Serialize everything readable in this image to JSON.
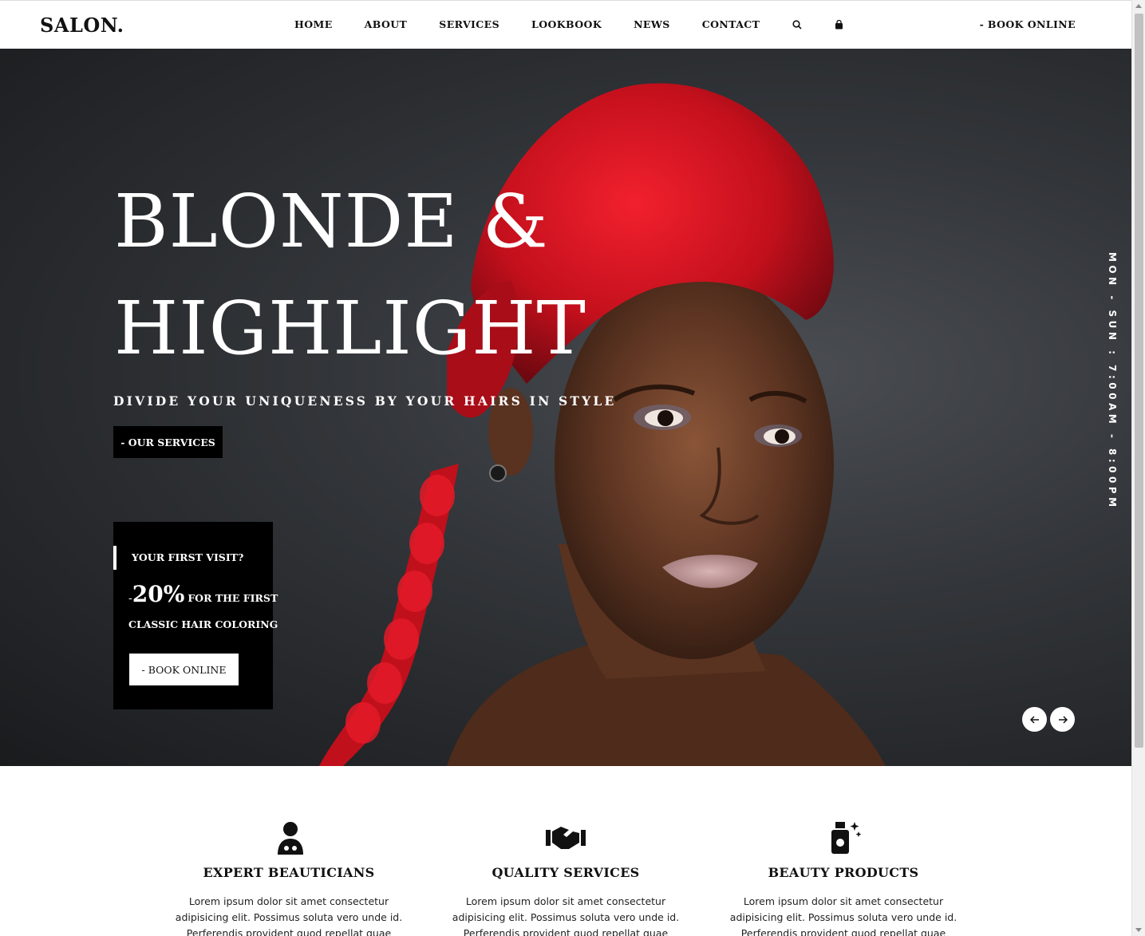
{
  "brand": {
    "logo": "SALON."
  },
  "nav": {
    "items": [
      "HOME",
      "ABOUT",
      "SERVICES",
      "LOOKBOOK",
      "NEWS",
      "CONTACT"
    ],
    "search_icon": "search-icon",
    "cart_icon": "shopping-bag-icon",
    "book_online": "- BOOK ONLINE"
  },
  "hero": {
    "title_line1": "BLONDE &",
    "title_line2": "HIGHLIGHT",
    "subtitle": "DIVIDE YOUR UNIQUENESS BY YOUR HAIRS IN STYLE",
    "services_button": "- OUR SERVICES",
    "hours": "MON - SUN : 7:00AM - 8:00PM",
    "prev_icon": "arrow-left-icon",
    "next_icon": "arrow-right-icon"
  },
  "promo": {
    "heading": "YOUR FIRST VISIT?",
    "dash": "-",
    "percent": "20%",
    "for_the_first": "FOR THE FIRST",
    "classic": "CLASSIC HAIR COLORING",
    "button": "- BOOK ONLINE"
  },
  "features": [
    {
      "icon": "beautician-icon",
      "title": "EXPERT BEAUTICIANS",
      "text": "Lorem ipsum dolor sit amet consectetur adipisicing elit. Possimus soluta vero unde id. Perferendis provident quod repellat quae"
    },
    {
      "icon": "handshake-icon",
      "title": "QUALITY SERVICES",
      "text": "Lorem ipsum dolor sit amet consectetur adipisicing elit. Possimus soluta vero unde id. Perferendis provident quod repellat quae"
    },
    {
      "icon": "beauty-product-icon",
      "title": "BEAUTY PRODUCTS",
      "text": "Lorem ipsum dolor sit amet consectetur adipisicing elit. Possimus soluta vero unde id. Perferendis provident quod repellat quae"
    }
  ],
  "colors": {
    "hair_red": "#d1121f",
    "background_dark": "#2b2d30",
    "black": "#000000",
    "white": "#ffffff"
  }
}
